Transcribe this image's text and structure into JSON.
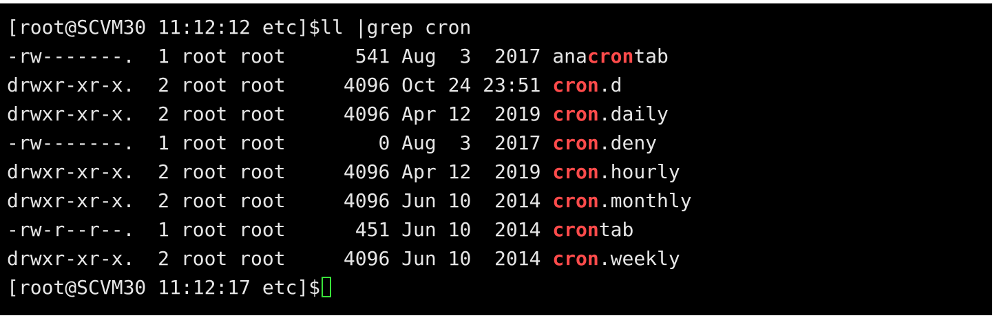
{
  "prompt_1": "[root@SCVM30 11:12:12 etc]$",
  "command": "ll |grep cron",
  "rows": [
    {
      "meta": "-rw-------.  1 root root      541 Aug  3  2017 ",
      "pre": "ana",
      "hl": "cron",
      "post": "tab"
    },
    {
      "meta": "drwxr-xr-x.  2 root root     4096 Oct 24 23:51 ",
      "pre": "",
      "hl": "cron",
      "post": ".d"
    },
    {
      "meta": "drwxr-xr-x.  2 root root     4096 Apr 12  2019 ",
      "pre": "",
      "hl": "cron",
      "post": ".daily"
    },
    {
      "meta": "-rw-------.  1 root root        0 Aug  3  2017 ",
      "pre": "",
      "hl": "cron",
      "post": ".deny"
    },
    {
      "meta": "drwxr-xr-x.  2 root root     4096 Apr 12  2019 ",
      "pre": "",
      "hl": "cron",
      "post": ".hourly"
    },
    {
      "meta": "drwxr-xr-x.  2 root root     4096 Jun 10  2014 ",
      "pre": "",
      "hl": "cron",
      "post": ".monthly"
    },
    {
      "meta": "-rw-r--r--.  1 root root      451 Jun 10  2014 ",
      "pre": "",
      "hl": "cron",
      "post": "tab"
    },
    {
      "meta": "drwxr-xr-x.  2 root root     4096 Jun 10  2014 ",
      "pre": "",
      "hl": "cron",
      "post": ".weekly"
    }
  ],
  "prompt_2": "[root@SCVM30 11:12:17 etc]$",
  "colors": {
    "background": "#000000",
    "text": "#e6e6e6",
    "grep_match": "#ff4b4b",
    "cursor": "#39e33a"
  }
}
